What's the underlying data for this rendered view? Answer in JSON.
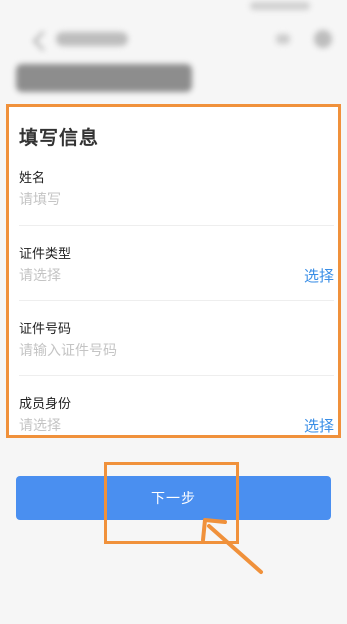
{
  "form": {
    "title": "填写信息",
    "fields": [
      {
        "label": "姓名",
        "placeholder": "请填写",
        "action": ""
      },
      {
        "label": "证件类型",
        "placeholder": "请选择",
        "action": "选择"
      },
      {
        "label": "证件号码",
        "placeholder": "请输入证件号码",
        "action": ""
      },
      {
        "label": "成员身份",
        "placeholder": "请选择",
        "action": "选择"
      }
    ]
  },
  "next_button": {
    "label": "下一步"
  },
  "annotation": {
    "color": "#f0913b"
  },
  "colors": {
    "accent": "#3a8ee6",
    "button": "#4a8ff0"
  }
}
